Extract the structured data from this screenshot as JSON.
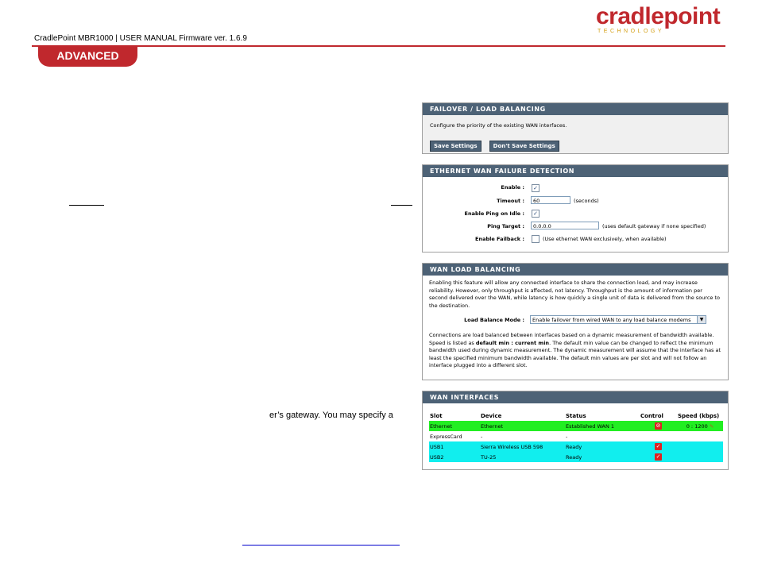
{
  "header": {
    "doc_title": "CradlePoint MBR1000 | USER MANUAL Firmware ver. 1.6.9",
    "logo_main": "cradlepoint",
    "logo_sub": "TECHNOLOGY",
    "section_tab": "ADVANCED"
  },
  "side_text": {
    "fragment": "er’s gateway. You may specify a"
  },
  "failover": {
    "title": "FAILOVER / LOAD BALANCING",
    "description": "Configure the priority of the existing WAN interfaces.",
    "save_label": "Save Settings",
    "dont_save_label": "Don't Save Settings"
  },
  "ethernet_detection": {
    "title": "ETHERNET WAN FAILURE DETECTION",
    "enable_label": "Enable :",
    "enable_checked": true,
    "timeout_label": "Timeout :",
    "timeout_value": "60",
    "timeout_unit": "(seconds)",
    "ping_idle_label": "Enable Ping on Idle :",
    "ping_idle_checked": true,
    "ping_target_label": "Ping Target :",
    "ping_target_value": "0.0.0.0",
    "ping_target_hint": "(uses default gateway if none specified)",
    "failback_label": "Enable Failback :",
    "failback_checked": false,
    "failback_hint": "(Use ethernet WAN exclusively, when available)"
  },
  "load_balancing": {
    "title": "WAN LOAD BALANCING",
    "intro": "Enabling this feature will allow any connected interface to share the connection load, and may increase reliability. However, only throughput is affected, not latency. Throughput is the amount of information per second delivered over the WAN, while latency is how quickly a single unit of data is delivered from the source to the destination.",
    "mode_label": "Load Balance Mode :",
    "mode_value": "Enable failover from wired WAN to any load balance modems",
    "notes_1": "Connections are load balanced between interfaces based on a dynamic measurement of bandwidth available. Speed is listed as ",
    "notes_bold": "default min : current min",
    "notes_2": ". The default min value can be changed to reflect the minimum bandwidth used during dynamic measurement. The dynamic measurement will assume that the interface has at least the specified minimum bandwidth available. The default min values are per slot and will not follow an interface plugged into a different slot."
  },
  "wan_interfaces": {
    "title": "WAN INTERFACES",
    "columns": [
      "Slot",
      "Device",
      "Status",
      "Control",
      "Speed (kbps)"
    ],
    "rows": [
      {
        "slot": "Ethernet",
        "device": "Ethernet",
        "status": "Established WAN 1",
        "control": "disconnect",
        "speed": "0 : 1200",
        "color": "#22ee22"
      },
      {
        "slot": "ExpressCard",
        "device": "-",
        "status": "-",
        "control": "",
        "speed": "",
        "color": "#ffffff"
      },
      {
        "slot": "USB1",
        "device": "Sierra Wireless USB 598",
        "status": "Ready",
        "control": "check",
        "speed": "",
        "color": "#11eeee"
      },
      {
        "slot": "USB2",
        "device": "TU-25",
        "status": "Ready",
        "control": "check",
        "speed": "",
        "color": "#11eeee"
      }
    ]
  },
  "colors": {
    "accent_red": "#c0282d",
    "panel_header": "#4d6276",
    "row_green": "#22ee22",
    "row_cyan": "#11eeee"
  }
}
